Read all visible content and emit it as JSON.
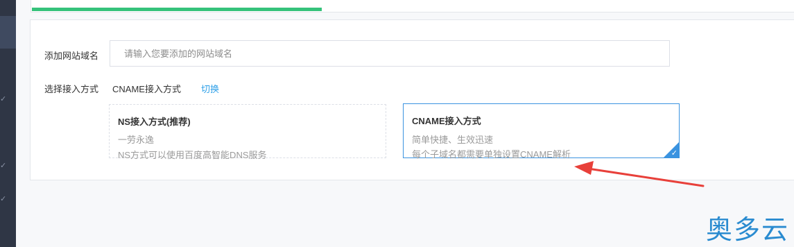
{
  "form": {
    "domain_label": "添加网站域名",
    "domain_placeholder": "请输入您要添加的网站域名",
    "access_label": "选择接入方式",
    "access_current": "CNAME接入方式",
    "switch_link": "切换"
  },
  "options": {
    "ns": {
      "title": "NS接入方式(推荐)",
      "line1": "一劳永逸",
      "line2": "NS方式可以使用百度高智能DNS服务"
    },
    "cname": {
      "title": "CNAME接入方式",
      "line1": "简单快捷、生效迅速",
      "line2": "每个子域名都需要单独设置CNAME解析",
      "selected": true
    }
  },
  "progress": {
    "fraction": 0.38
  },
  "watermark": "奥多云",
  "colors": {
    "accent": "#3a93e0",
    "link": "#2ea0e8",
    "progress": "#35c27a",
    "sidebar": "#2f3645",
    "arrow": "#e8403a"
  }
}
